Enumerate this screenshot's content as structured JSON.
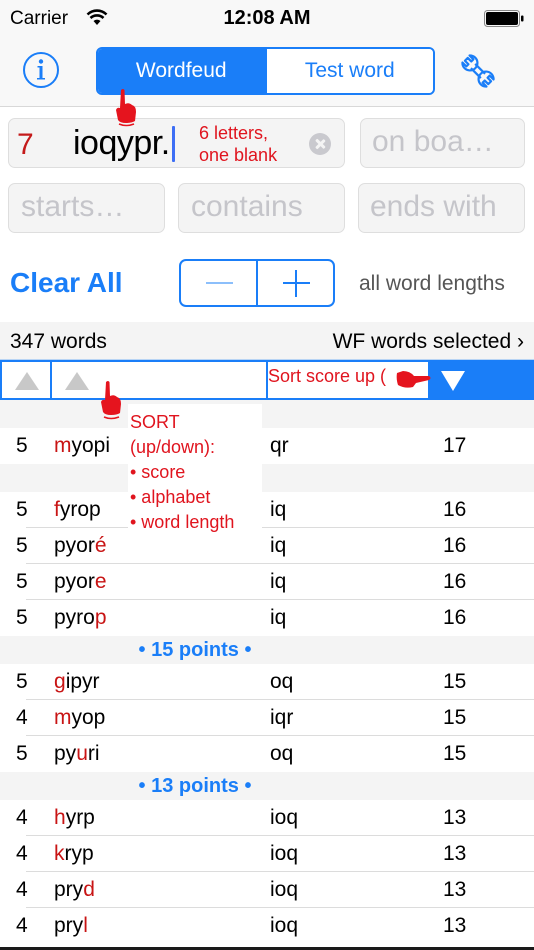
{
  "status_bar": {
    "carrier": "Carrier",
    "time": "12:08 AM",
    "wifi_icon": "wifi-icon",
    "battery_icon": "battery-full-icon"
  },
  "nav": {
    "info_icon": "info-circle-icon",
    "tabs": [
      {
        "label": "Wordfeud",
        "active": true
      },
      {
        "label": "Test word",
        "active": false
      }
    ],
    "settings_icon": "wrench-icon"
  },
  "search": {
    "rack": {
      "count": "7",
      "value": "ioqypr.",
      "annotation_line1": "6 letters,",
      "annotation_line2": "one blank"
    },
    "on_board_placeholder": "on boa…",
    "starts_placeholder": "starts…",
    "contains_placeholder": "contains",
    "ends_placeholder": "ends with"
  },
  "controls": {
    "clear_all_label": "Clear All",
    "stepper_minus": "−",
    "stepper_plus": "+",
    "length_label": "all word lengths"
  },
  "results": {
    "count_label": "347 words",
    "wordlist_label": "WF words selected",
    "wordlist_chevron": "›"
  },
  "sort_header": {
    "length_sort": "ascending",
    "word_sort": "ascending",
    "score_sort": "descending",
    "annotation": "Sort score up ("
  },
  "sort_popup": {
    "title": "SORT",
    "subtitle": "(up/down):",
    "items": [
      "• score",
      "• alphabet",
      "• word length"
    ]
  },
  "accent_color": "#1a7ef8",
  "highlight_color": "#c81414",
  "list": [
    {
      "type": "section",
      "label": ""
    },
    {
      "type": "row",
      "len": "5",
      "word_parts": [
        {
          "t": "m",
          "new": true
        },
        {
          "t": "yopi",
          "new": false
        }
      ],
      "rack_left": "qr",
      "score": "17"
    },
    {
      "type": "section",
      "label": ""
    },
    {
      "type": "row",
      "len": "5",
      "word_parts": [
        {
          "t": "f",
          "new": true
        },
        {
          "t": "yrop",
          "new": false
        }
      ],
      "rack_left": "iq",
      "score": "16"
    },
    {
      "type": "row",
      "len": "5",
      "word_parts": [
        {
          "t": "pyor",
          "new": false
        },
        {
          "t": "é",
          "new": true
        }
      ],
      "rack_left": "iq",
      "score": "16"
    },
    {
      "type": "row",
      "len": "5",
      "word_parts": [
        {
          "t": "pyor",
          "new": false
        },
        {
          "t": "e",
          "new": true
        }
      ],
      "rack_left": "iq",
      "score": "16"
    },
    {
      "type": "row",
      "len": "5",
      "word_parts": [
        {
          "t": "pyro",
          "new": false
        },
        {
          "t": "p",
          "new": true
        }
      ],
      "rack_left": "iq",
      "score": "16"
    },
    {
      "type": "section",
      "label": "• 15 points •"
    },
    {
      "type": "row",
      "len": "5",
      "word_parts": [
        {
          "t": "g",
          "new": true
        },
        {
          "t": "ipyr",
          "new": false
        }
      ],
      "rack_left": "oq",
      "score": "15"
    },
    {
      "type": "row",
      "len": "4",
      "word_parts": [
        {
          "t": "m",
          "new": true
        },
        {
          "t": "yop",
          "new": false
        }
      ],
      "rack_left": "iqr",
      "score": "15"
    },
    {
      "type": "row",
      "len": "5",
      "word_parts": [
        {
          "t": "py",
          "new": false
        },
        {
          "t": "u",
          "new": true
        },
        {
          "t": "ri",
          "new": false
        }
      ],
      "rack_left": "oq",
      "score": "15"
    },
    {
      "type": "section",
      "label": "• 13 points •"
    },
    {
      "type": "row",
      "len": "4",
      "word_parts": [
        {
          "t": "h",
          "new": true
        },
        {
          "t": "yrp",
          "new": false
        }
      ],
      "rack_left": "ioq",
      "score": "13"
    },
    {
      "type": "row",
      "len": "4",
      "word_parts": [
        {
          "t": "k",
          "new": true
        },
        {
          "t": "ryp",
          "new": false
        }
      ],
      "rack_left": "ioq",
      "score": "13"
    },
    {
      "type": "row",
      "len": "4",
      "word_parts": [
        {
          "t": "pry",
          "new": false
        },
        {
          "t": "d",
          "new": true
        }
      ],
      "rack_left": "ioq",
      "score": "13"
    },
    {
      "type": "row",
      "len": "4",
      "word_parts": [
        {
          "t": "pry",
          "new": false
        },
        {
          "t": "l",
          "new": true
        }
      ],
      "rack_left": "ioq",
      "score": "13"
    }
  ]
}
